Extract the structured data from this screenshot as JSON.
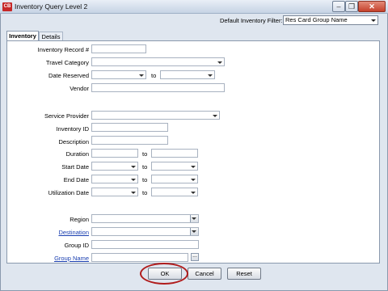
{
  "window": {
    "title": "Inventory Query Level 2",
    "logo": "CB",
    "close_glyph": "✕",
    "min_glyph": "–",
    "max_glyph": "❐"
  },
  "filter": {
    "label": "Default Inventory Filter:",
    "value": "Res Card Group Name"
  },
  "tabs": [
    {
      "label": "Inventory"
    },
    {
      "label": "Details"
    }
  ],
  "form": {
    "inventory_record": "Inventory Record #",
    "travel_category": "Travel Category",
    "date_reserved": "Date Reserved",
    "vendor": "Vendor",
    "service_provider": "Service Provider",
    "inventory_id": "Inventory ID",
    "description": "Description",
    "duration": "Duration",
    "start_date": "Start Date",
    "end_date": "End Date",
    "utilization_date": "Utilization Date",
    "region": "Region",
    "destination": "Destination",
    "group_id": "Group ID",
    "group_name": "Group Name",
    "to": "to"
  },
  "buttons": {
    "ok": "OK",
    "cancel": "Cancel",
    "reset": "Reset",
    "ellipsis": "..."
  },
  "colors": {
    "highlight": "#b01c1c",
    "link": "#1a3fb0"
  }
}
